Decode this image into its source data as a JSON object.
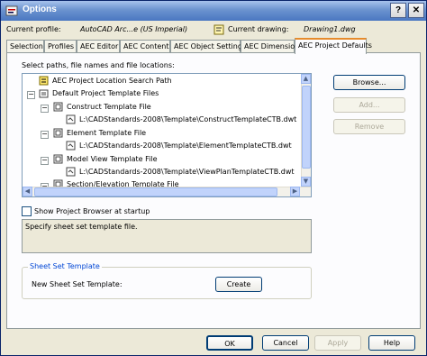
{
  "window": {
    "title": "Options",
    "help_btn": "?",
    "close_btn": "✕"
  },
  "profile": {
    "label": "Current profile:",
    "value": "AutoCAD Arc...e (US Imperial)",
    "drawing_label": "Current drawing:",
    "drawing_value": "Drawing1.dwg"
  },
  "tabs": [
    {
      "label": "Selection"
    },
    {
      "label": "Profiles"
    },
    {
      "label": "AEC Editor"
    },
    {
      "label": "AEC Content"
    },
    {
      "label": "AEC Object Settings"
    },
    {
      "label": "AEC Dimension"
    },
    {
      "label": "AEC Project Defaults"
    }
  ],
  "panel": {
    "paths_label": "Select paths, file names and file locations:",
    "tree": [
      {
        "label": "AEC Project Location Search Path"
      },
      {
        "label": "Default Project Template Files"
      },
      {
        "label": "Construct Template File"
      },
      {
        "label": "L:\\CADStandards-2008\\Template\\ConstructTemplateCTB.dwt"
      },
      {
        "label": "Element Template File"
      },
      {
        "label": "L:\\CADStandards-2008\\Template\\ElementTemplateCTB.dwt"
      },
      {
        "label": "Model View Template File"
      },
      {
        "label": "L:\\CADStandards-2008\\Template\\ViewPlanTemplateCTB.dwt"
      },
      {
        "label": "Section/Elevation Template File"
      }
    ],
    "browse": "Browse...",
    "add": "Add...",
    "remove": "Remove",
    "show_browser": "Show Project Browser at startup",
    "description": "Specify sheet set template file.",
    "sheet_group_title": "Sheet Set Template",
    "new_sheet_label": "New Sheet Set Template:",
    "create": "Create"
  },
  "footer": {
    "ok": "OK",
    "cancel": "Cancel",
    "apply": "Apply",
    "help": "Help"
  }
}
